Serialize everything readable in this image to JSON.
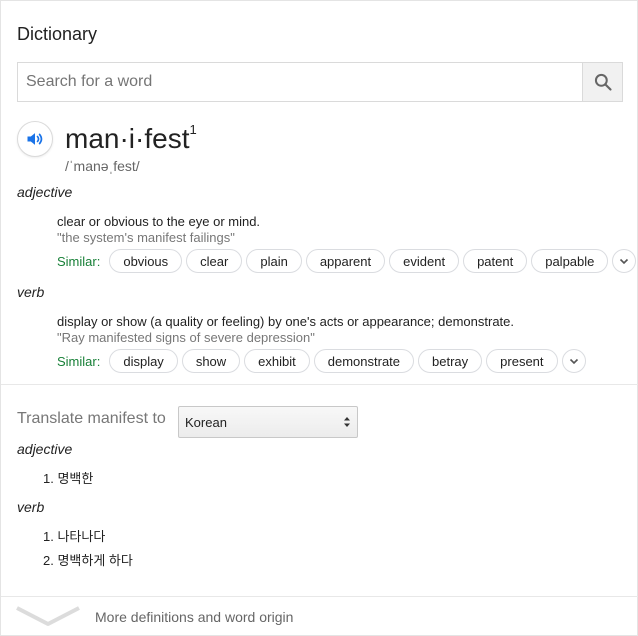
{
  "header": {
    "title": "Dictionary"
  },
  "search": {
    "placeholder": "Search for a word",
    "value": ""
  },
  "entry": {
    "word": "man·i·fest",
    "superscript": "1",
    "phonetic": "/ˈmanəˌfest/"
  },
  "senses": [
    {
      "pos": "adjective",
      "definition": "clear or obvious to the eye or mind.",
      "example": "\"the system's manifest failings\"",
      "similar_label": "Similar:",
      "similar": [
        "obvious",
        "clear",
        "plain",
        "apparent",
        "evident",
        "patent",
        "palpable"
      ]
    },
    {
      "pos": "verb",
      "definition": "display or show (a quality or feeling) by one's acts or appearance; demonstrate.",
      "example": "\"Ray manifested signs of severe depression\"",
      "similar_label": "Similar:",
      "similar": [
        "display",
        "show",
        "exhibit",
        "demonstrate",
        "betray",
        "present"
      ]
    }
  ],
  "translate": {
    "label": "Translate manifest to",
    "language": "Korean",
    "groups": [
      {
        "pos": "adjective",
        "items": [
          "1. 명백한"
        ]
      },
      {
        "pos": "verb",
        "items": [
          "1. 나타나다",
          "2. 명백하게 하다"
        ]
      }
    ]
  },
  "footer": {
    "more_label": "More definitions and word origin"
  },
  "colors": {
    "similar_green": "#188038",
    "speaker_blue": "#1a73e8"
  }
}
